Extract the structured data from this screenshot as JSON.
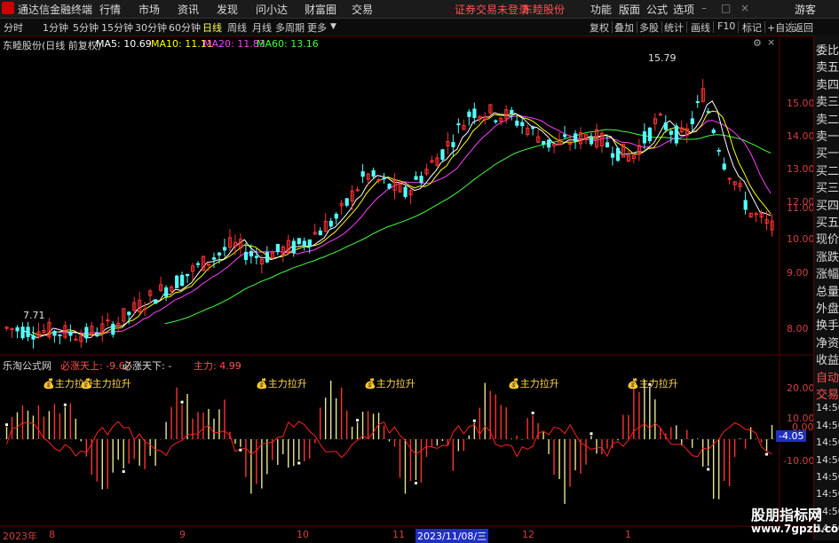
{
  "app": {
    "title": "通达信金融终端",
    "menu": [
      "行情",
      "市场",
      "资讯",
      "发现",
      "问小达",
      "财富圈",
      "交易"
    ],
    "status_text": "证券交易未登录",
    "stock_name_top": "东睦股份",
    "right_menu": [
      "功能",
      "版面",
      "公式",
      "选项"
    ],
    "guest": "游客"
  },
  "toolbar": {
    "periods": [
      "分时",
      "1分钟",
      "5分钟",
      "15分钟",
      "30分钟",
      "60分钟",
      "日线",
      "周线",
      "月线",
      "多周期",
      "更多"
    ],
    "active_period": "日线",
    "tools": [
      "复权",
      "叠加",
      "多股",
      "统计",
      "画线",
      "F10",
      "标记",
      "+自选",
      "返回"
    ]
  },
  "main_chart": {
    "title": "东睦股份(日线 前复权)",
    "ma": [
      {
        "label": "MA5: 10.69",
        "color": "#ffffff"
      },
      {
        "label": "MA10: 11.11",
        "color": "#ffff00"
      },
      {
        "label": "MA20: 11.83",
        "color": "#ff40ff"
      },
      {
        "label": "MA60: 13.16",
        "color": "#40ff40"
      }
    ],
    "high_label": "15.79",
    "low_label": "7.71",
    "y_ticks": [
      "15.00",
      "14.00",
      "13.00",
      "12.00",
      "11.00",
      "10.00",
      "9.00",
      "8.00"
    ]
  },
  "sub_chart": {
    "title": "乐淘公式网",
    "ind1": "必涨天上: -9.67",
    "ind2": "必涨天下: -",
    "ind3": "主力: 4.99",
    "signal": "主力拉升",
    "current_value": "-4.05",
    "y_ticks": [
      "20.00",
      "10.00",
      "0.00",
      "-10.00"
    ]
  },
  "x_axis": {
    "labels": [
      "2023年",
      "8",
      "9",
      "10",
      "11",
      "2023/11/08/三",
      "12",
      "1"
    ]
  },
  "right_panel": {
    "items": [
      "委比",
      "卖五",
      "卖四",
      "卖三",
      "卖二",
      "卖一",
      "买一",
      "买二",
      "买三",
      "买四",
      "买五",
      "现价",
      "涨跌",
      "涨幅",
      "总量",
      "外盘",
      "换手",
      "净资",
      "收益",
      "自动",
      "交易",
      "14:50",
      "14:50",
      "14:50",
      "14:50",
      "14:50",
      "14:50",
      "14:50",
      "14:50"
    ]
  },
  "watermark": {
    "line1": "股朋指标网",
    "line2": "www.7gpzb.com"
  },
  "colors": {
    "up": "#ff3232",
    "down": "#54ffff",
    "grid": "#5a0000",
    "axis_text": "#d04040"
  }
}
